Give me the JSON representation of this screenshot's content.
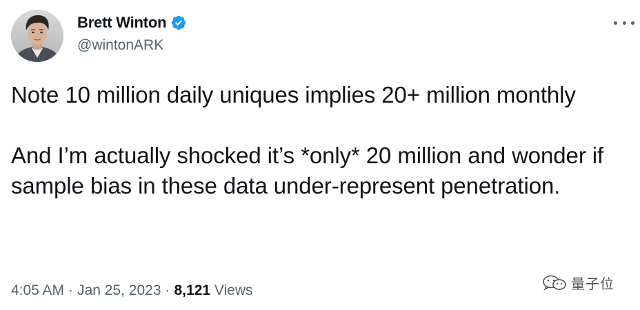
{
  "author": {
    "display_name": "Brett Winton",
    "handle": "@wintonARK",
    "verified": true,
    "verified_color": "#1d9bf0"
  },
  "tweet": {
    "paragraphs": [
      "Note 10 million daily uniques implies 20+ million monthly",
      "And I’m actually shocked it’s *only* 20 million and wonder if sample bias in these data under-represent penetration."
    ]
  },
  "meta": {
    "time": "4:05 AM",
    "separator": "·",
    "date": "Jan 25, 2023",
    "views_count": "8,121",
    "views_label": "Views"
  },
  "watermark": {
    "text": "量子位"
  },
  "icons": {
    "more": "more-icon",
    "verified": "verified-badge-icon",
    "watermark": "wechat-logo-icon"
  },
  "colors": {
    "text_primary": "#0f1419",
    "text_secondary": "#536471"
  }
}
